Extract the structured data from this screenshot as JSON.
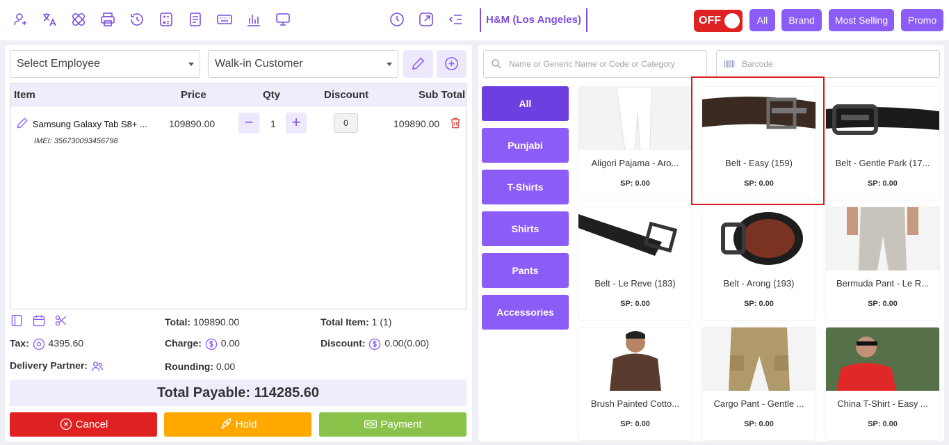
{
  "topbar": {
    "icons": [
      "user-icon",
      "translate-icon",
      "bandage-icon",
      "printer-icon",
      "history-icon",
      "calculator-icon",
      "document-icon",
      "keyboard-icon",
      "bar-chart-icon",
      "monitor-icon",
      "clock-icon",
      "expand-icon",
      "collapse-menu-icon"
    ],
    "store_name": "H&M (Los Angeles)",
    "toggle_label": "OFF",
    "filters": [
      "All",
      "Brand",
      "Most Selling",
      "Promo"
    ]
  },
  "left": {
    "employee_select": "Select Employee",
    "customer_select": "Walk-in Customer",
    "columns": {
      "item": "Item",
      "price": "Price",
      "qty": "Qty",
      "discount": "Discount",
      "subtotal": "Sub Total"
    },
    "cart": [
      {
        "name": "Samsung Galaxy Tab S8+ ...",
        "imei": "IMEI: 356730093456798",
        "price": "109890.00",
        "qty": "1",
        "discount": "0",
        "subtotal": "109890.00"
      }
    ],
    "summary": {
      "total_label": "Total:",
      "total_value": "109890.00",
      "total_item_label": "Total Item:",
      "total_item_value": "1 (1)",
      "tax_label": "Tax:",
      "tax_value": "4395.60",
      "charge_label": "Charge:",
      "charge_value": "0.00",
      "discount_label": "Discount:",
      "discount_value": "0.00(0.00)",
      "delivery_label": "Delivery Partner:",
      "rounding_label": "Rounding:",
      "rounding_value": "0.00"
    },
    "payable_label": "Total Payable: 114285.60",
    "buttons": {
      "cancel": "Cancel",
      "hold": "Hold",
      "payment": "Payment"
    },
    "colors": {
      "cancel": "#e02121",
      "hold": "#ffa800",
      "payment": "#8bc34a"
    }
  },
  "right": {
    "search_placeholder": "Name or Generic Name or Code or Category",
    "barcode_placeholder": "Barcode",
    "categories": [
      "All",
      "Punjabi",
      "T-Shirts",
      "Shirts",
      "Pants",
      "Accessories"
    ],
    "products": [
      {
        "name": "Aligori Pajama - Aro...",
        "sp": "SP: 0.00"
      },
      {
        "name": "Belt - Easy (159)",
        "sp": "SP: 0.00"
      },
      {
        "name": "Belt - Gentle Park (17...",
        "sp": "SP: 0.00"
      },
      {
        "name": "Belt - Le Reve (183)",
        "sp": "SP: 0.00"
      },
      {
        "name": "Belt - Arong (193)",
        "sp": "SP: 0.00"
      },
      {
        "name": "Bermuda Pant - Le R...",
        "sp": "SP: 0.00"
      },
      {
        "name": "Brush Painted Cotto...",
        "sp": "SP: 0.00"
      },
      {
        "name": "Cargo Pant - Gentle ...",
        "sp": "SP: 0.00"
      },
      {
        "name": "China T-Shirt - Easy ...",
        "sp": "SP: 0.00"
      }
    ]
  },
  "accent_color": "#8b5cf6"
}
